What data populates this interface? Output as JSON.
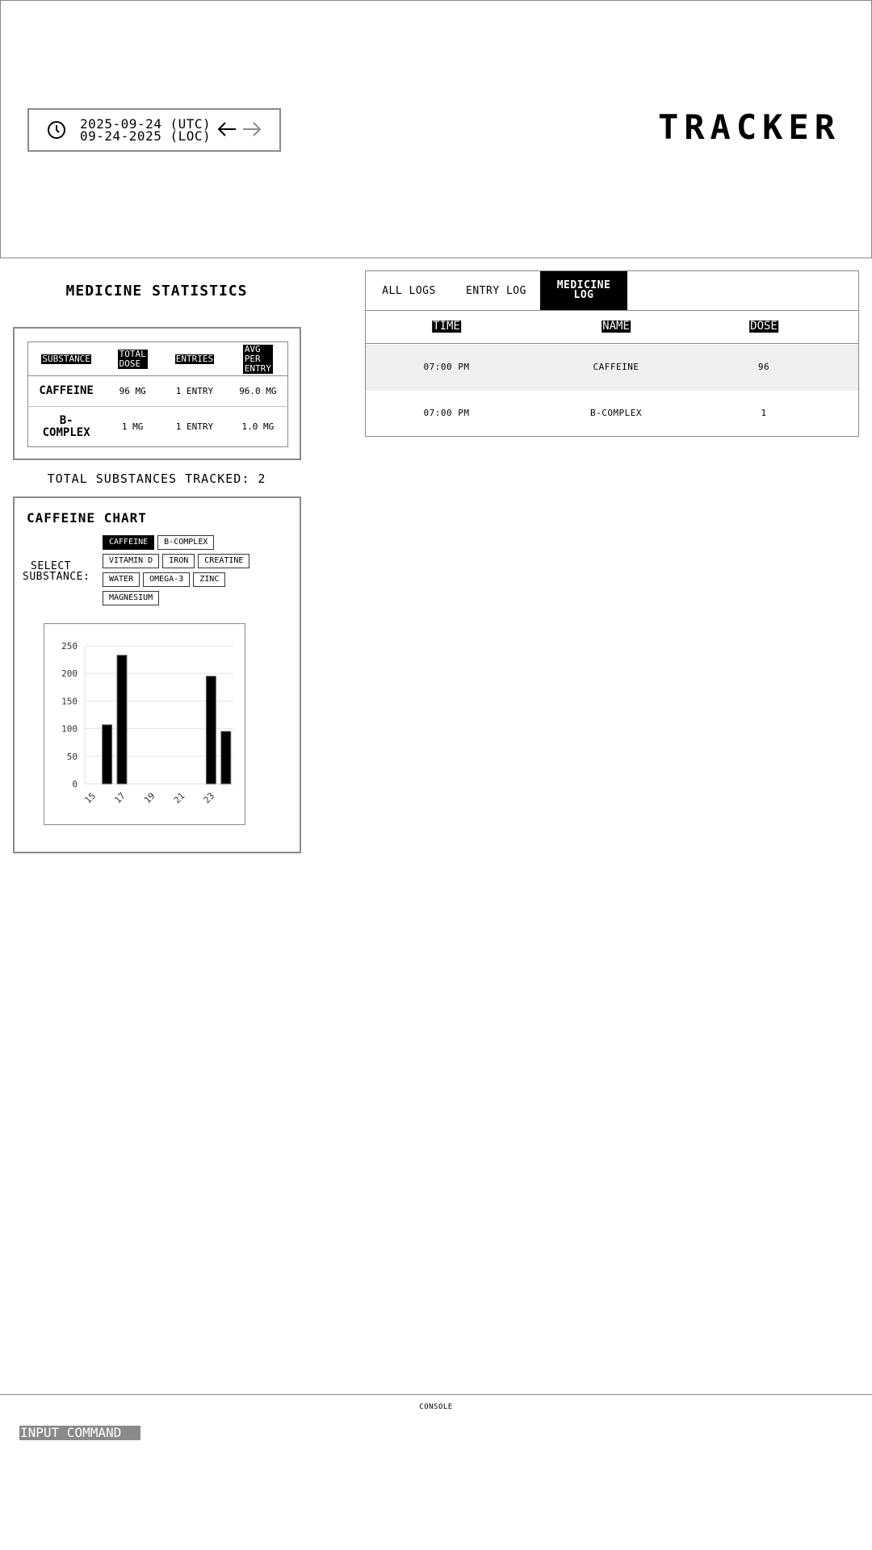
{
  "header": {
    "date_utc": "2025-09-24 (UTC)",
    "date_local": "09-24-2025 (LOC)",
    "app_title": "TRACKER"
  },
  "stats": {
    "title": "MEDICINE STATISTICS",
    "columns": {
      "substance": "SUBSTANCE",
      "total_dose_l1": "TOTAL",
      "total_dose_l2": "DOSE",
      "entries": "ENTRIES",
      "avg_l1": "AVG",
      "avg_l2": "PER",
      "avg_l3": "ENTRY"
    },
    "rows": [
      {
        "substance": "CAFFEINE",
        "total": "96 MG",
        "entries": "1 ENTRY",
        "avg": "96.0 MG"
      },
      {
        "substance_l1": "B-",
        "substance_l2": "COMPLEX",
        "total": "1 MG",
        "entries": "1 ENTRY",
        "avg": "1.0 MG"
      }
    ],
    "total_tracked": "TOTAL SUBSTANCES TRACKED: 2"
  },
  "chart_panel": {
    "title": "CAFFEINE CHART",
    "select_label_l1": "SELECT",
    "select_label_l2": "SUBSTANCE:",
    "chips": [
      "CAFFEINE",
      "B-COMPLEX",
      "VITAMIN D",
      "IRON",
      "CREATINE",
      "WATER",
      "OMEGA-3",
      "ZINC",
      "MAGNESIUM"
    ],
    "selected_chip": "CAFFEINE"
  },
  "chart_data": {
    "type": "bar",
    "x": [
      15,
      16,
      17,
      18,
      19,
      20,
      21,
      22,
      23,
      24
    ],
    "values": [
      0,
      107,
      233,
      0,
      0,
      0,
      0,
      0,
      195,
      95
    ],
    "x_tick_labels": [
      "15",
      "17",
      "19",
      "21",
      "23"
    ],
    "y_ticks": [
      0,
      50,
      100,
      150,
      200,
      250
    ],
    "ylim": [
      0,
      250
    ],
    "grid": true,
    "bar_color": "#000000"
  },
  "tabs": {
    "all_logs": "ALL LOGS",
    "entry_log": "ENTRY LOG",
    "medicine_log_l1": "MEDICINE",
    "medicine_log_l2": "LOG",
    "active": "medicine_log"
  },
  "log_table": {
    "headers": {
      "time": "TIME",
      "name": "NAME",
      "dose": "DOSE"
    },
    "rows": [
      {
        "time": "07:00 PM",
        "name": "CAFFEINE",
        "dose": "96"
      },
      {
        "time": "07:00 PM",
        "name": "B-COMPLEX",
        "dose": "1"
      }
    ]
  },
  "console": {
    "label": "CONSOLE",
    "placeholder": "INPUT COMMAND"
  },
  "colors": {
    "border": "#8a8a8a",
    "active_bg": "#000000",
    "row_alt": "#f0f0f0"
  }
}
